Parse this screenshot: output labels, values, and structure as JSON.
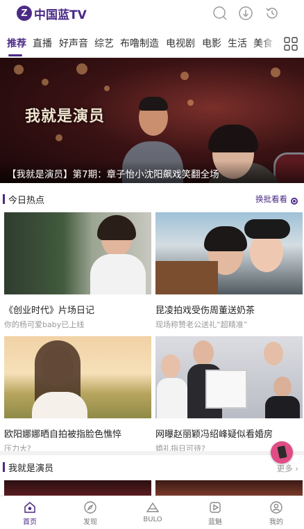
{
  "header": {
    "logo_mark": "Z",
    "logo_text": "中国蓝TV",
    "icons": [
      "search-icon",
      "download-icon",
      "history-icon"
    ]
  },
  "tabs": [
    {
      "label": "推荐",
      "active": true
    },
    {
      "label": "直播",
      "active": false
    },
    {
      "label": "好声音",
      "active": false
    },
    {
      "label": "综艺",
      "active": false
    },
    {
      "label": "布噜制造",
      "active": false
    },
    {
      "label": "电视剧",
      "active": false
    },
    {
      "label": "电影",
      "active": false
    },
    {
      "label": "生活",
      "active": false
    },
    {
      "label": "美食",
      "active": false
    }
  ],
  "banner": {
    "show_art_text": "我就是演员",
    "caption": "【我就是演员】第7期：章子怡小沈阳飙戏笑翻全场"
  },
  "hot_section": {
    "title": "今日热点",
    "refresh_label": "换批看看",
    "cards": [
      {
        "title": "《创业时代》片场日记",
        "subtitle": "你的杨可爱baby已上线"
      },
      {
        "title": "昆凌拍戏受伤周董送奶茶",
        "subtitle": "现场称赞老公送礼“超精准”"
      },
      {
        "title": "欧阳娜娜晒自拍被指脸色憔悴",
        "subtitle": "压力大?"
      },
      {
        "title": "网曝赵丽颖冯绍峰疑似看婚房",
        "subtitle": "婚礼指日可待?"
      }
    ]
  },
  "actor_section": {
    "title": "我就是演员",
    "more_label": "更多"
  },
  "bottom_nav": [
    {
      "label": "首页",
      "icon": "home-icon",
      "active": true
    },
    {
      "label": "发现",
      "icon": "discover-icon",
      "active": false
    },
    {
      "label": "BULO",
      "icon": "bulo-icon",
      "active": false
    },
    {
      "label": "蓝魅",
      "icon": "play-icon",
      "active": false
    },
    {
      "label": "我的",
      "icon": "user-icon",
      "active": false
    }
  ],
  "colors": {
    "brand": "#4b2a86",
    "float_badge": "#e04c85"
  }
}
